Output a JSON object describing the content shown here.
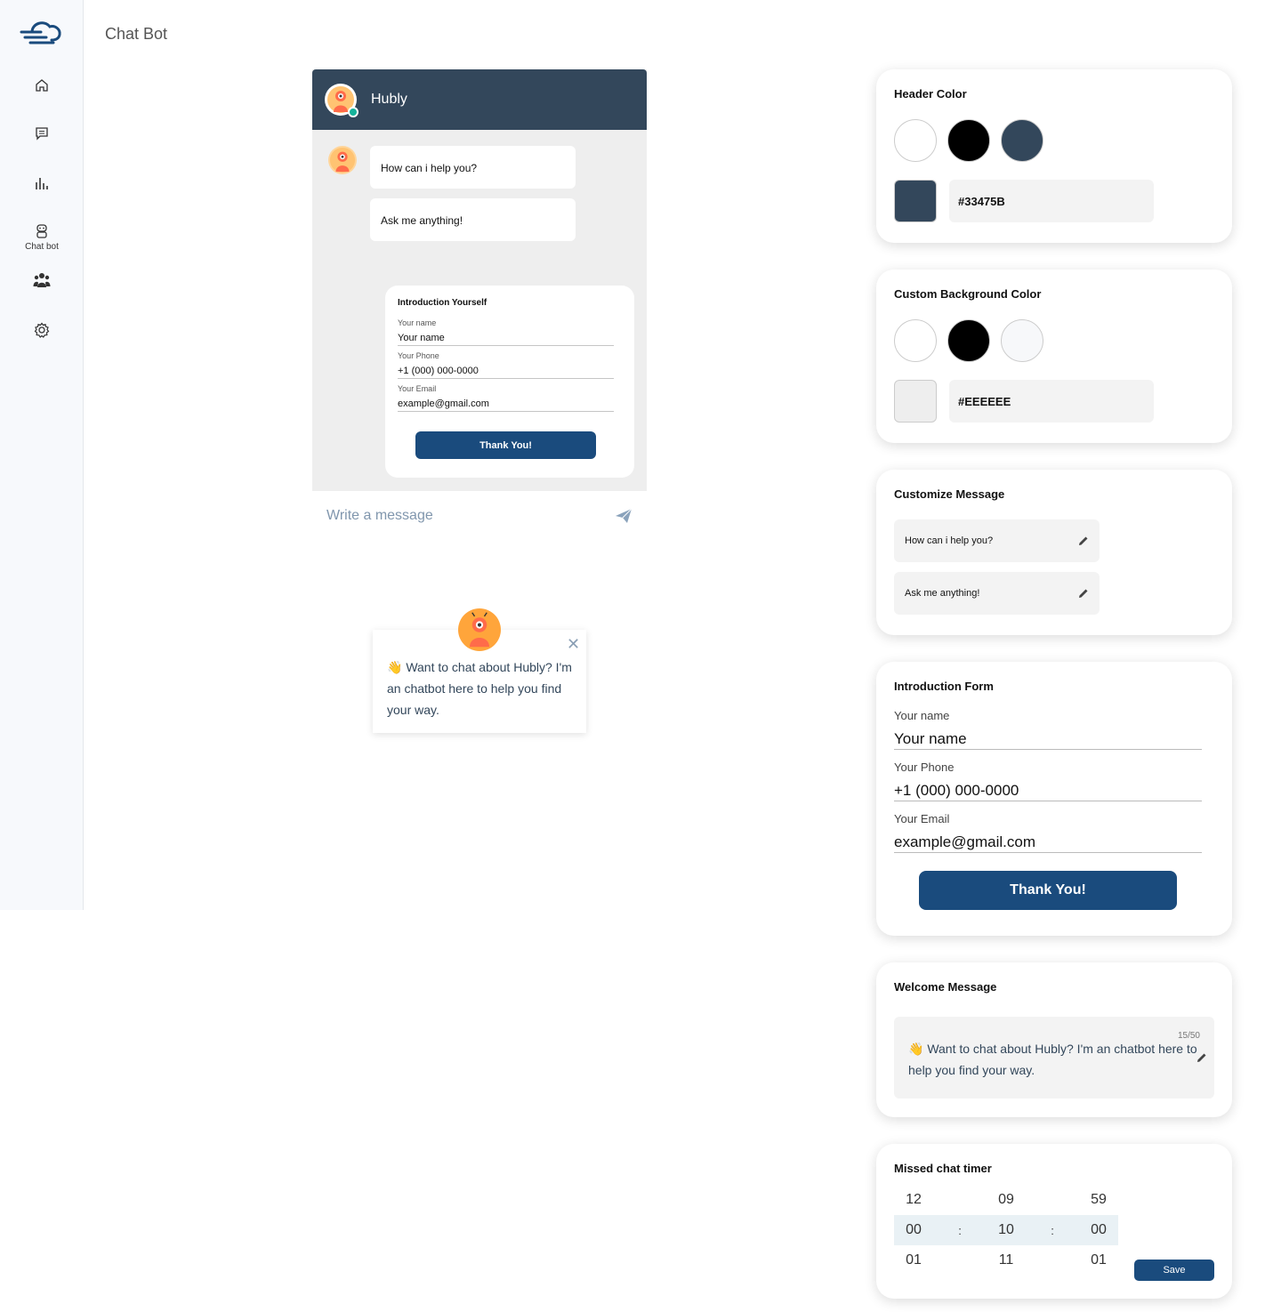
{
  "page": {
    "title": "Chat Bot"
  },
  "sidebar": {
    "chatbot_label": "Chat bot"
  },
  "chat": {
    "bot_name": "Hubly",
    "messages": [
      "How can i help you?",
      "Ask me anything!"
    ],
    "intro": {
      "title": "Introduction Yourself",
      "name_label": "Your name",
      "name_value": "Your name",
      "phone_label": "Your Phone",
      "phone_value": "+1 (000) 000-0000",
      "email_label": "Your Email",
      "email_value": "example@gmail.com",
      "button": "Thank You!"
    },
    "input_placeholder": "Write a message"
  },
  "popup": {
    "text": "👋 Want to chat about Hubly? I'm an chatbot here to help you find your way."
  },
  "header_color": {
    "title": "Header Color",
    "swatches": [
      "#ffffff",
      "#000000",
      "#33475B"
    ],
    "value": "#33475B"
  },
  "background_color": {
    "title": "Custom Background Color",
    "swatches": [
      "#ffffff",
      "#000000",
      "#F7F8FA"
    ],
    "value": "#EEEEEE"
  },
  "customize_message": {
    "title": "Customize Message",
    "messages": [
      "How can i help you?",
      "Ask me anything!"
    ]
  },
  "intro_form": {
    "title": "Introduction Form",
    "name_label": "Your name",
    "name_value": "Your name",
    "phone_label": "Your Phone",
    "phone_value": "+1 (000) 000-0000",
    "email_label": "Your Email",
    "email_value": "example@gmail.com",
    "button": "Thank You!"
  },
  "welcome": {
    "title": "Welcome Message",
    "counter": "15/50",
    "text": "👋 Want to chat about Hubly? I'm an chatbot here to help you find your way."
  },
  "timer": {
    "title": "Missed chat timer",
    "rows": [
      [
        "12",
        "09",
        "59"
      ],
      [
        "00",
        "10",
        "00"
      ],
      [
        "01",
        "11",
        "01"
      ]
    ],
    "separator": ":",
    "save": "Save"
  }
}
